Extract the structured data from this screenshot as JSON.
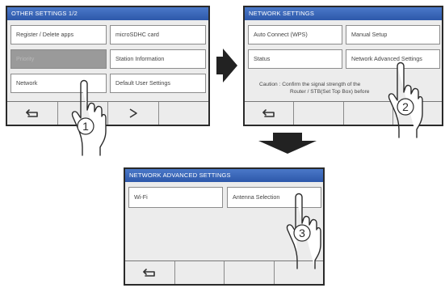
{
  "screen1": {
    "title": "OTHER SETTINGS 1/2",
    "buttons": [
      "Register / Delete apps",
      "microSDHC card",
      "Priority",
      "Station Information",
      "Network",
      "Default User Settings"
    ],
    "step": "1",
    "nav": {
      "back_icon": "back-arrow-icon",
      "next_icon": "chevron-right-icon"
    }
  },
  "screen2": {
    "title": "NETWORK SETTINGS",
    "buttons": [
      "Auto Connect (WPS)",
      "Manual Setup",
      "Status",
      "Network Advanced Settings"
    ],
    "caution_line1": "Caution : Confirm the signal strength of the",
    "caution_line2": "Router / STB(Set Top Box) before",
    "step": "2",
    "nav": {
      "back_icon": "back-arrow-icon"
    }
  },
  "screen3": {
    "title": "NETWORK ADVANCED SETTINGS",
    "buttons": [
      "Wi-Fi",
      "Antenna Selection"
    ],
    "step": "3",
    "nav": {
      "back_icon": "back-arrow-icon"
    }
  }
}
